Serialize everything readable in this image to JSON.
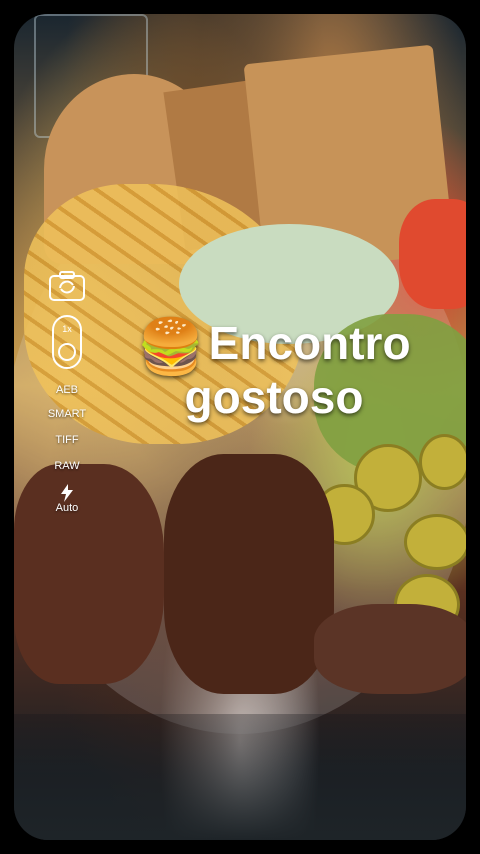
{
  "caption": {
    "emoji": "🍔",
    "line1": "Encontro",
    "line2": "gostoso"
  },
  "camera_controls": {
    "aeb_label": "AEB",
    "smart_label": "SMART",
    "tiff_label": "TIFF",
    "raw_label": "RAW",
    "flash_label": "Auto"
  },
  "colors": {
    "background": "#000000",
    "text": "#ffffff"
  }
}
